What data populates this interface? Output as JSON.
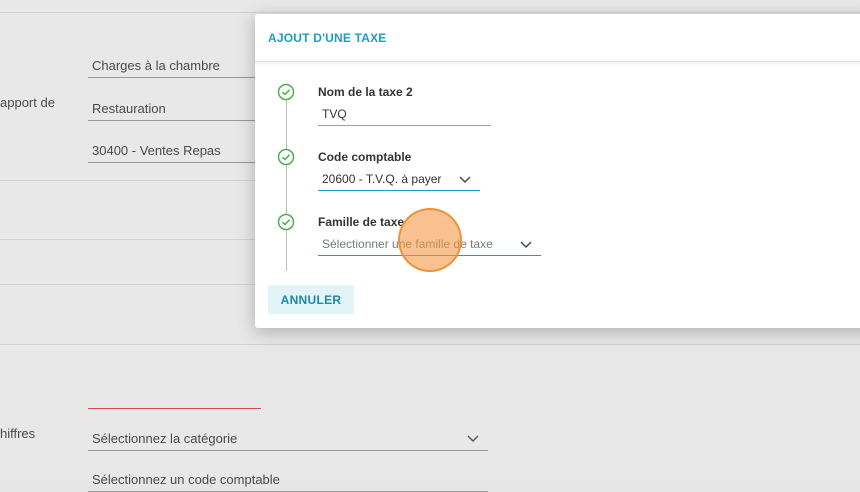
{
  "background_form": {
    "labels": {
      "rapport": "apport de",
      "chiffres": "hiffres"
    },
    "fields": {
      "field_1": "Charges à la chambre",
      "field_2": "Restauration",
      "field_3": "30400 - Ventes Repas",
      "category_select": "Sélectionnez la catégorie",
      "code_select": "Sélectionnez un code comptable"
    }
  },
  "modal": {
    "title": "AJOUT D'UNE TAXE",
    "steps": [
      {
        "label": "Nom de la taxe 2",
        "value": "TVQ",
        "status_icon": "check-circle-icon"
      },
      {
        "label": "Code comptable",
        "value": "20600 - T.V.Q. à payer",
        "status_icon": "check-circle-icon"
      },
      {
        "label": "Famille de taxe",
        "placeholder": "Sélectionner une famille de taxe",
        "status_icon": "check-circle-icon"
      }
    ],
    "cancel_label": "ANNULER"
  },
  "colors": {
    "accent": "#1b9fc0",
    "step_check": "#4caf50",
    "error_line": "#d94a4a",
    "click_indicator": "#f5964680"
  }
}
